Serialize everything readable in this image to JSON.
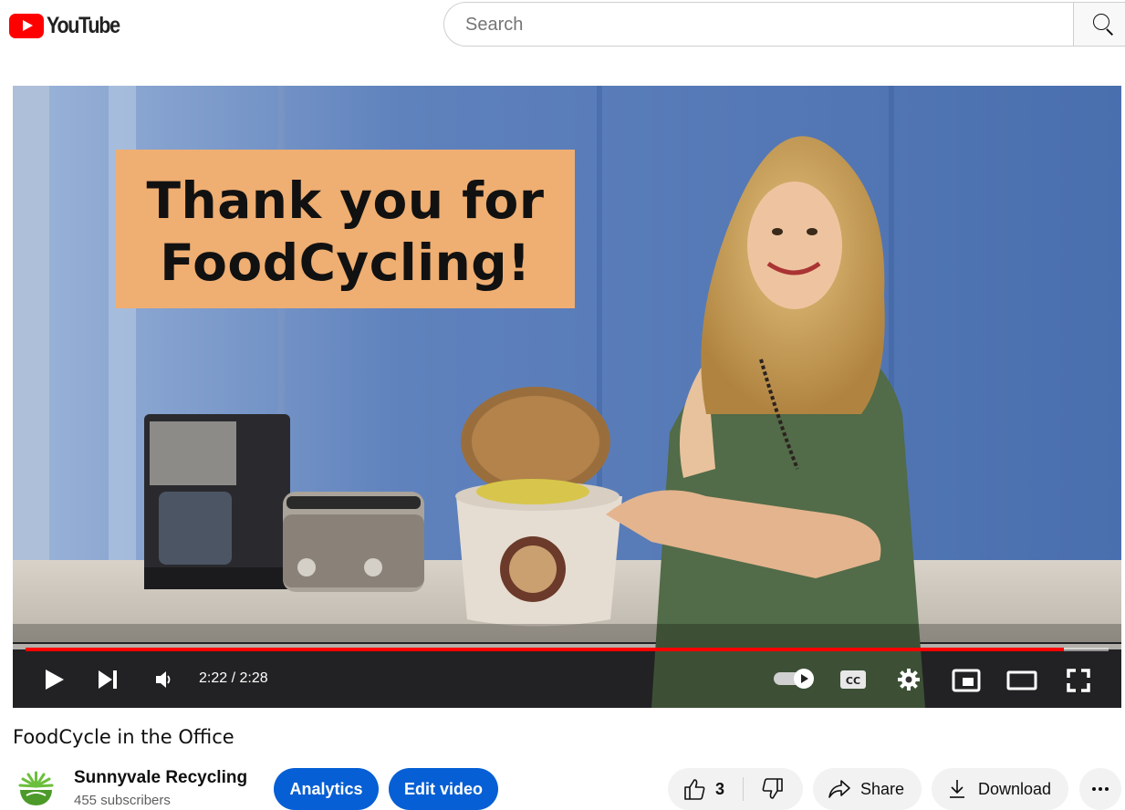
{
  "header": {
    "logo_text": "YouTube",
    "search": {
      "placeholder": "Search",
      "value": ""
    },
    "icons": {
      "logo": "youtube-logo-icon",
      "search": "search-icon"
    }
  },
  "player": {
    "overlay_text": "Thank you for FoodCycling!",
    "time_display": "2:22 / 2:28",
    "current_time": "2:22",
    "duration": "2:28",
    "progress_fraction": 0.959,
    "autoplay_on": true,
    "controls": [
      "play-icon",
      "next-icon",
      "volume-icon",
      "autoplay-toggle",
      "captions-icon",
      "settings-icon",
      "miniplayer-icon",
      "theater-mode-icon",
      "fullscreen-icon"
    ],
    "captions_label": "CC"
  },
  "video": {
    "title": "FoodCycle in the Office",
    "channel_name": "Sunnyvale Recycling",
    "subscribers": "455 subscribers"
  },
  "actions": {
    "analytics": "Analytics",
    "edit_video": "Edit video",
    "like_count": "3",
    "share": "Share",
    "download": "Download",
    "more": "more-icon"
  },
  "colors": {
    "brand_red": "#ff0000",
    "accent_blue": "#065fd4",
    "progress_red": "#ff0000",
    "card_orange": "#efae72"
  }
}
